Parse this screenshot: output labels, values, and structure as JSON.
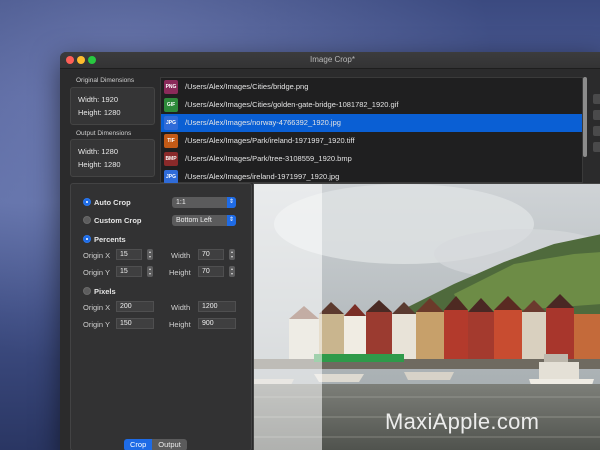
{
  "window": {
    "title": "Image Crop*"
  },
  "original_dimensions": {
    "label": "Original Dimensions",
    "width": "Width: 1920",
    "height": "Height: 1280"
  },
  "output_dimensions": {
    "label": "Output Dimensions",
    "width": "Width: 1280",
    "height": "Height: 1280"
  },
  "files": [
    {
      "badge": "PNG",
      "badge_color": "#8a2a5a",
      "path": "/Users/Alex/Images/Cities/bridge.png",
      "selected": false
    },
    {
      "badge": "GIF",
      "badge_color": "#2d8a3a",
      "path": "/Users/Alex/Images/Cities/golden-gate-bridge-1081782_1920.gif",
      "selected": false
    },
    {
      "badge": "JPG",
      "badge_color": "#2f6bd8",
      "path": "/Users/Alex/Images/norway-4766392_1920.jpg",
      "selected": true
    },
    {
      "badge": "TIF",
      "badge_color": "#c35a16",
      "path": "/Users/Alex/Images/Park/ireland-1971997_1920.tiff",
      "selected": false
    },
    {
      "badge": "BMP",
      "badge_color": "#8a2a2a",
      "path": "/Users/Alex/Images/Park/tree-3108559_1920.bmp",
      "selected": false
    },
    {
      "badge": "JPG",
      "badge_color": "#2f6bd8",
      "path": "/Users/Alex/Images/ireland-1971997_1920.jpg",
      "selected": false
    }
  ],
  "settings": {
    "auto_crop": {
      "label": "Auto Crop",
      "checked": true,
      "ratio": "1:1"
    },
    "custom_crop": {
      "label": "Custom Crop",
      "checked": false,
      "anchor": "Bottom Left"
    },
    "percents": {
      "label": "Percents",
      "checked": true,
      "origin_x_label": "Origin X",
      "origin_x": "15",
      "origin_y_label": "Origin Y",
      "origin_y": "15",
      "width_label": "Width",
      "width": "70",
      "height_label": "Height",
      "height": "70"
    },
    "pixels": {
      "label": "Pixels",
      "checked": false,
      "origin_x_label": "Origin X",
      "origin_x": "200",
      "origin_y_label": "Origin Y",
      "origin_y": "150",
      "width_label": "Width",
      "width": "1200",
      "height_label": "Height",
      "height": "900"
    }
  },
  "tabs": {
    "crop": "Crop",
    "output": "Output"
  },
  "watermark": "MaxiApple.com",
  "colors": {
    "accent": "#1e6be6",
    "selection": "#0a5fd4",
    "window_bg": "#2b2b2c"
  }
}
